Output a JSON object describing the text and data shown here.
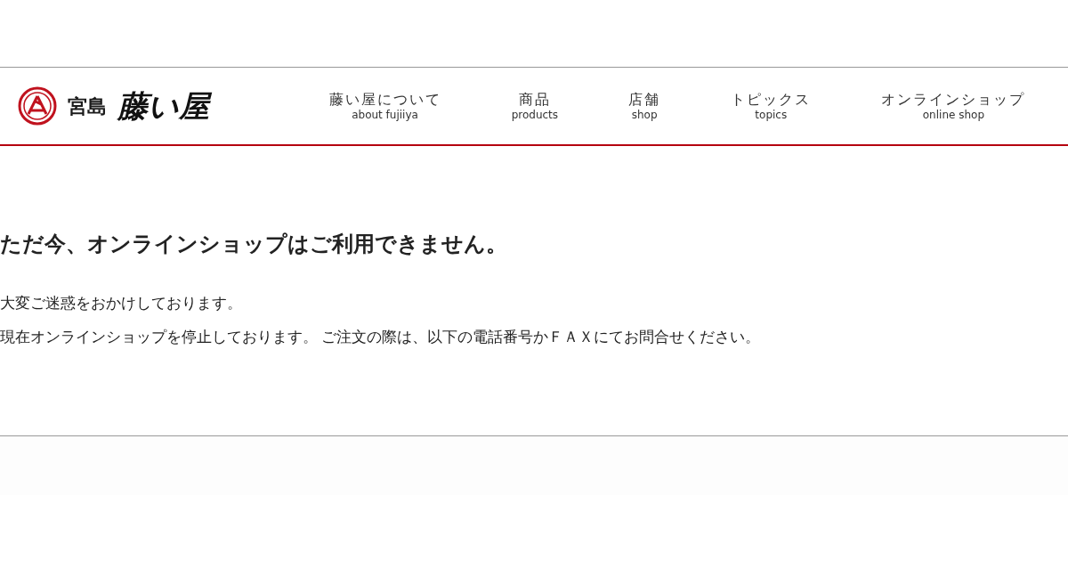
{
  "logo": {
    "prefix": "宮島",
    "name": "藤い屋"
  },
  "nav": [
    {
      "label": "藤い屋について",
      "sublabel": "about fujiiya"
    },
    {
      "label": "商品",
      "sublabel": "products"
    },
    {
      "label": "店舗",
      "sublabel": "shop"
    },
    {
      "label": "トピックス",
      "sublabel": "topics"
    },
    {
      "label": "オンラインショップ",
      "sublabel": "online shop"
    }
  ],
  "notice": {
    "heading": "ただ今、オンラインショップはご利用できません。",
    "paragraphs": [
      "大変ご迷惑をおかけしております。",
      "現在オンラインショップを停止しております。 ご注文の際は、以下の電話番号かＦＡＸにてお問合せください。"
    ]
  }
}
